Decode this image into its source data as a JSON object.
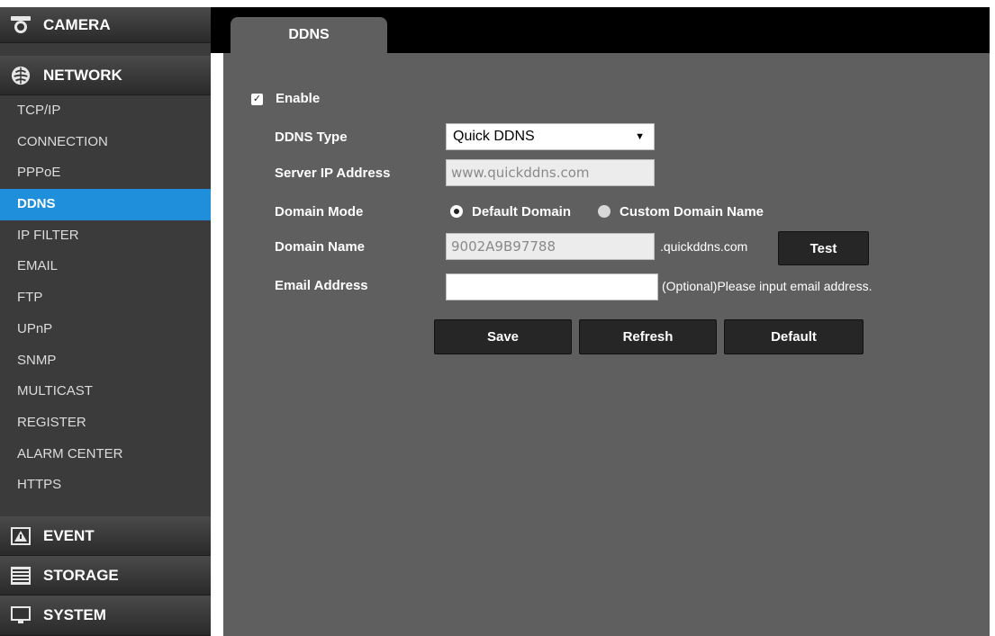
{
  "sidebar": {
    "categories": {
      "camera": "CAMERA",
      "network": "NETWORK",
      "event": "EVENT",
      "storage": "STORAGE",
      "system": "SYSTEM"
    },
    "network_items": [
      "TCP/IP",
      "CONNECTION",
      "PPPoE",
      "DDNS",
      "IP FILTER",
      "EMAIL",
      "FTP",
      "UPnP",
      "SNMP",
      "MULTICAST",
      "REGISTER",
      "ALARM CENTER",
      "HTTPS"
    ],
    "active_item": "DDNS",
    "icons": {
      "camera": "camera-icon",
      "network": "network-globe-icon",
      "event": "alarm-event-icon",
      "storage": "storage-list-icon",
      "system": "monitor-icon"
    }
  },
  "tab": {
    "label": "DDNS"
  },
  "form": {
    "enable": {
      "label": "Enable",
      "checked": true
    },
    "ddns_type": {
      "label": "DDNS Type",
      "value": "Quick DDNS"
    },
    "server_ip": {
      "label": "Server IP Address",
      "value": "www.quickddns.com"
    },
    "domain_mode": {
      "label": "Domain Mode",
      "options": [
        "Default Domain",
        "Custom Domain Name"
      ],
      "selected": "Default Domain"
    },
    "domain_name": {
      "label": "Domain Name",
      "value": "9002A9B97788",
      "suffix": ".quickddns.com",
      "test_label": "Test"
    },
    "email": {
      "label": "Email Address",
      "value": "",
      "hint": "(Optional)Please input email address."
    }
  },
  "actions": {
    "save": "Save",
    "refresh": "Refresh",
    "default": "Default"
  },
  "colors": {
    "active_item": "#1f8fdc",
    "panel": "#5f5f5f",
    "sidebar": "#3b3b3b"
  }
}
